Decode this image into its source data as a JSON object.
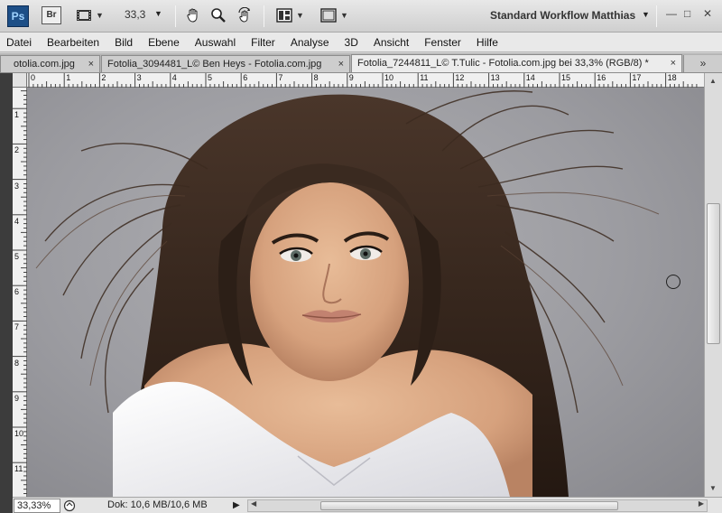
{
  "app": {
    "logo": "Ps",
    "bridge_label": "Br",
    "zoom_level": "33,3",
    "workspace": "Standard Workflow Matthias"
  },
  "menu": [
    "Datei",
    "Bearbeiten",
    "Bild",
    "Ebene",
    "Auswahl",
    "Filter",
    "Analyse",
    "3D",
    "Ansicht",
    "Fenster",
    "Hilfe"
  ],
  "tabs": [
    {
      "label": "otolia.com.jpg",
      "active": false
    },
    {
      "label": "Fotolia_3094481_L© Ben Heys - Fotolia.com.jpg",
      "active": false
    },
    {
      "label": "Fotolia_7244811_L© T.Tulic - Fotolia.com.jpg bei 33,3% (RGB/8) *",
      "active": true
    }
  ],
  "tab_close_glyph": "×",
  "tab_overflow_glyph": "»",
  "ruler": {
    "h_ticks": [
      "0",
      "1",
      "2",
      "3",
      "4",
      "5",
      "6",
      "7",
      "8",
      "9",
      "10",
      "11",
      "12",
      "13",
      "14",
      "15",
      "16",
      "17",
      "18"
    ],
    "v_ticks": [
      "0",
      "1",
      "2",
      "3",
      "4",
      "5",
      "6",
      "7",
      "8",
      "9",
      "10",
      "11"
    ]
  },
  "status": {
    "zoom": "33,33%",
    "doc_info": "Dok: 10,6 MB/10,6 MB"
  },
  "window_controls": {
    "minimize": "—",
    "restore": "□",
    "close": "✕"
  },
  "icons": {
    "screen_mode": "film-strip-icon",
    "hand": "hand-icon",
    "zoom": "magnifier-icon",
    "rotate": "rotate-view-icon",
    "arrange": "arrange-documents-icon",
    "screen_mode_2": "screen-mode-icon"
  },
  "colors": {
    "ps_blue": "#1d4f87",
    "backdrop_gray": "#9c9ca1",
    "hair_brown": "#3a2a20",
    "skin": "#d9a985",
    "shirt_white": "#f2f2f4"
  }
}
